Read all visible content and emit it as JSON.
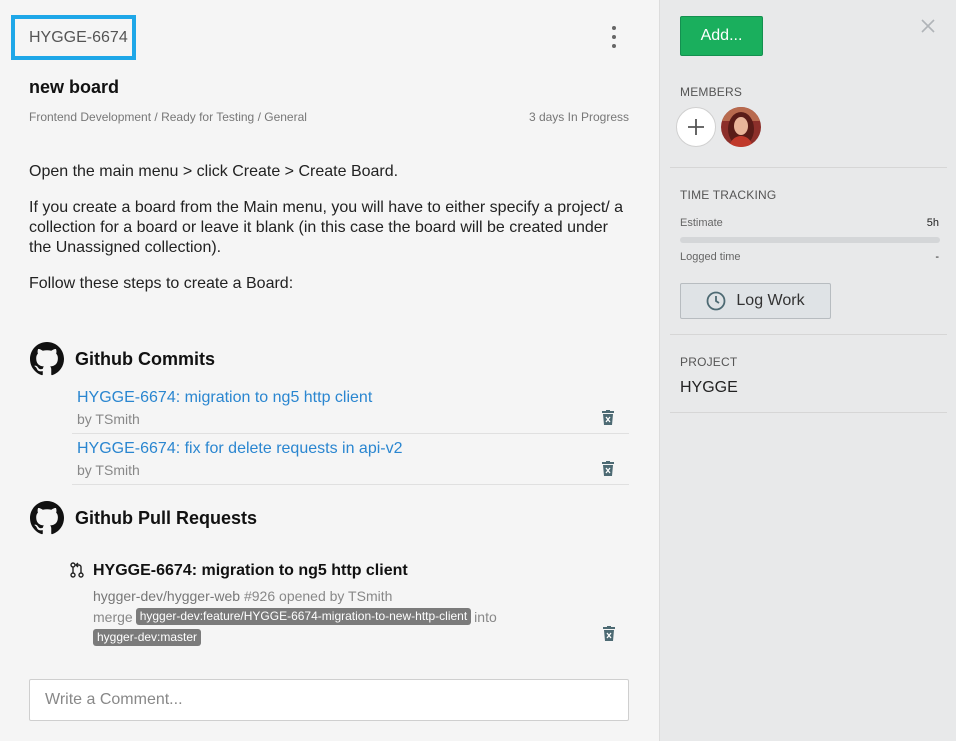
{
  "ticket": {
    "id": "HYGGE-6674",
    "title": "new board",
    "breadcrumb": "Frontend Development / Ready for Testing / General",
    "progress": "3 days In Progress"
  },
  "description": [
    "Open the main menu > click Create > Create Board.",
    "If you create a board from the Main menu, you will have to either specify a project/ a collection for a board or leave it blank (in this case the board will be created under the Unassigned collection).",
    "Follow these steps to create a Board:"
  ],
  "commits": {
    "heading": "Github Commits",
    "items": [
      {
        "message": "HYGGE-6674: migration to ng5 http client",
        "author": "by TSmith"
      },
      {
        "message": "HYGGE-6674: fix for delete requests in api-v2",
        "author": "by TSmith"
      }
    ]
  },
  "pull_requests": {
    "heading": "Github Pull Requests",
    "items": [
      {
        "title": "HYGGE-6674: migration to ng5 http client",
        "repo": "hygger-dev/hygger-web",
        "number": "#926",
        "opened_by": "opened by TSmith",
        "merge_word": "merge",
        "source_branch": "hygger-dev:feature/HYGGE-6674-migration-to-new-http-client",
        "into_word": "into",
        "target_branch": "hygger-dev:master"
      }
    ]
  },
  "comment": {
    "placeholder": "Write a Comment..."
  },
  "sidebar": {
    "add_label": "Add...",
    "members_label": "MEMBERS",
    "time_tracking_label": "TIME TRACKING",
    "estimate_label": "Estimate",
    "estimate_value": "5h",
    "logged_label": "Logged time",
    "logged_value": "-",
    "log_work_label": "Log Work",
    "project_label": "PROJECT",
    "project_value": "HYGGE"
  },
  "colors": {
    "accent_blue": "#1ea7e8",
    "link": "#2a86d0",
    "add_button": "#1aaf5d"
  }
}
